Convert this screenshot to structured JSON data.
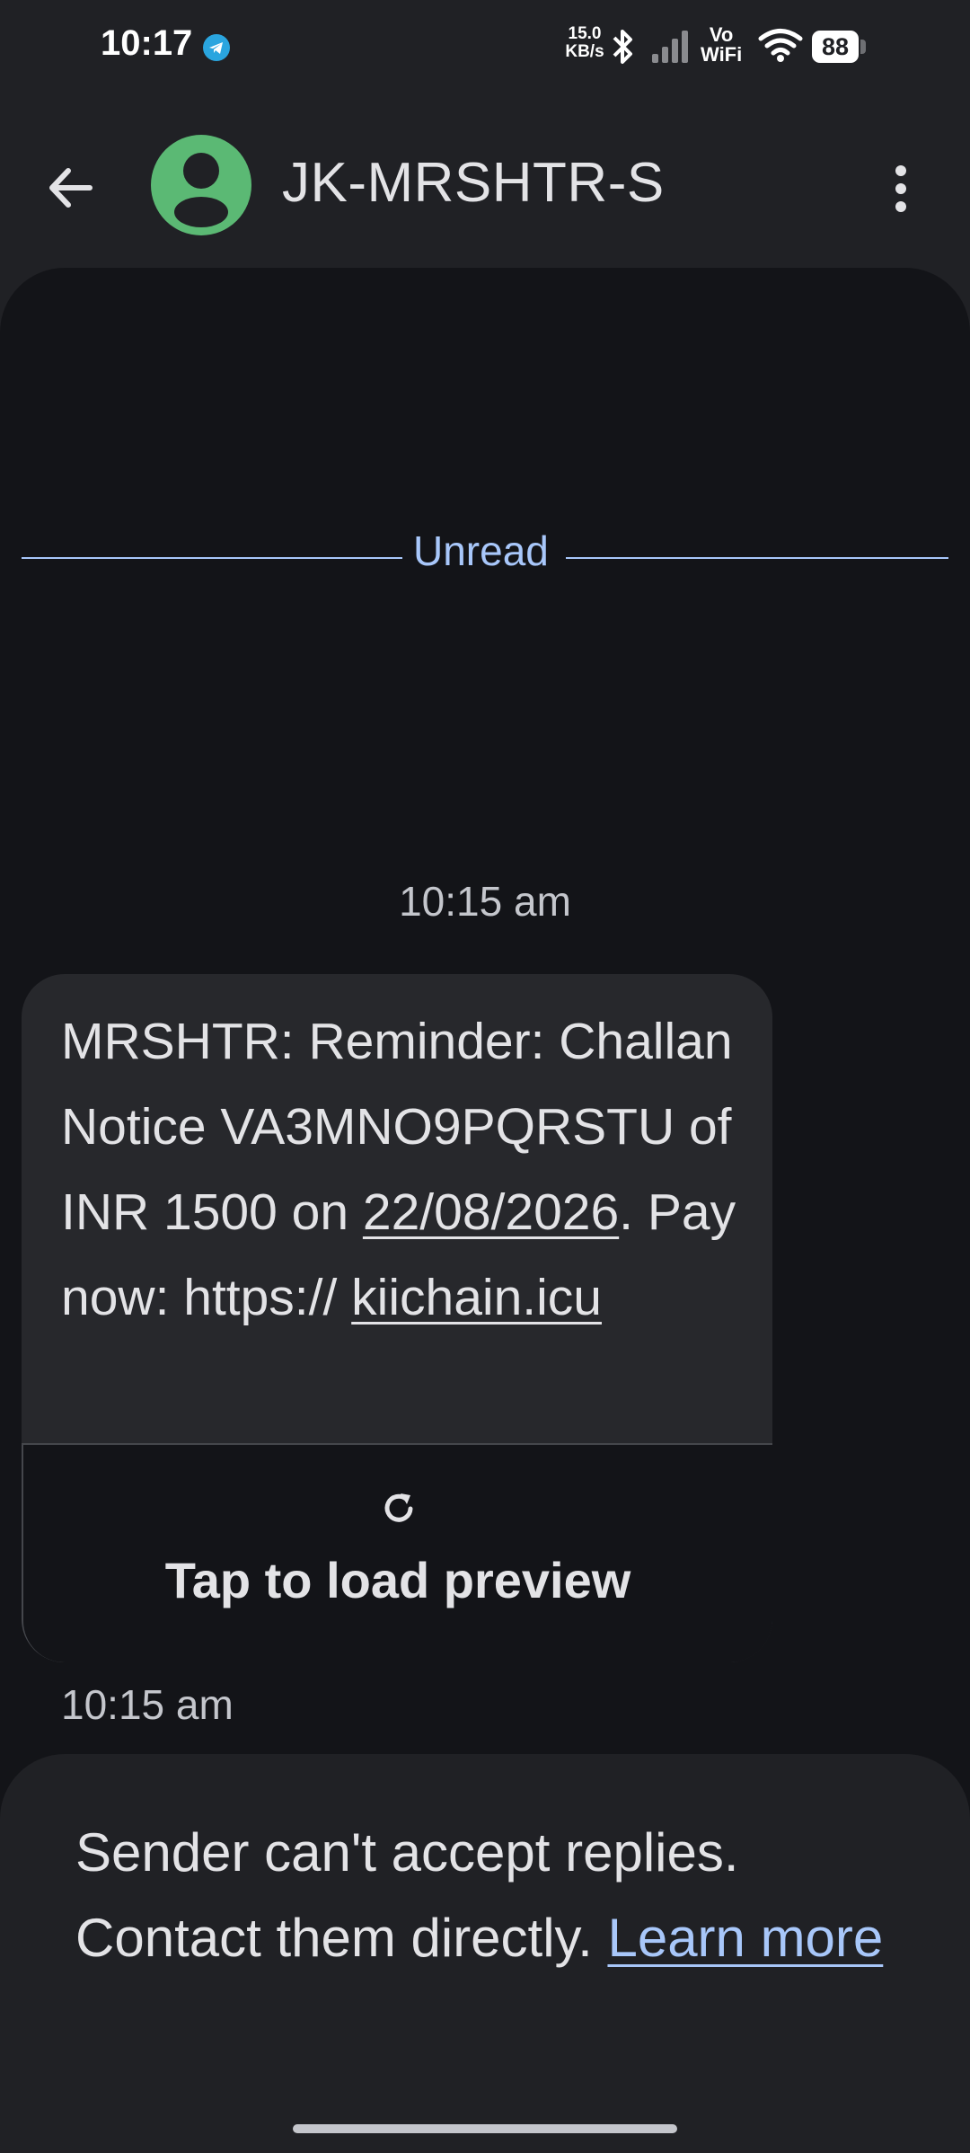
{
  "status_bar": {
    "time": "10:17",
    "speed_value": "15.0",
    "speed_unit": "KB/s",
    "volte_top": "Vo",
    "volte_bottom": "WiFi",
    "battery": "88"
  },
  "header": {
    "title": "JK-MRSHTR-S",
    "avatar_color": "#5bb974"
  },
  "divider": {
    "label": "Unread",
    "color": "#a8c7fa"
  },
  "conversation": {
    "date_header": "10:15 am",
    "message": {
      "text_part1": "MRSHTR: Reminder: Challan Notice VA3MNO9PQRSTU of INR 1500 on ",
      "date_link": "22/08/2026",
      "text_part2": ". Pay now: https:// ",
      "url_link": "kiichain.icu",
      "preview_label": "Tap to load preview",
      "timestamp": "10:15 am"
    }
  },
  "footer_notice": {
    "text": "Sender can't accept replies. Contact them directly. ",
    "link_label": "Learn more",
    "link_color": "#a8c7fa"
  }
}
